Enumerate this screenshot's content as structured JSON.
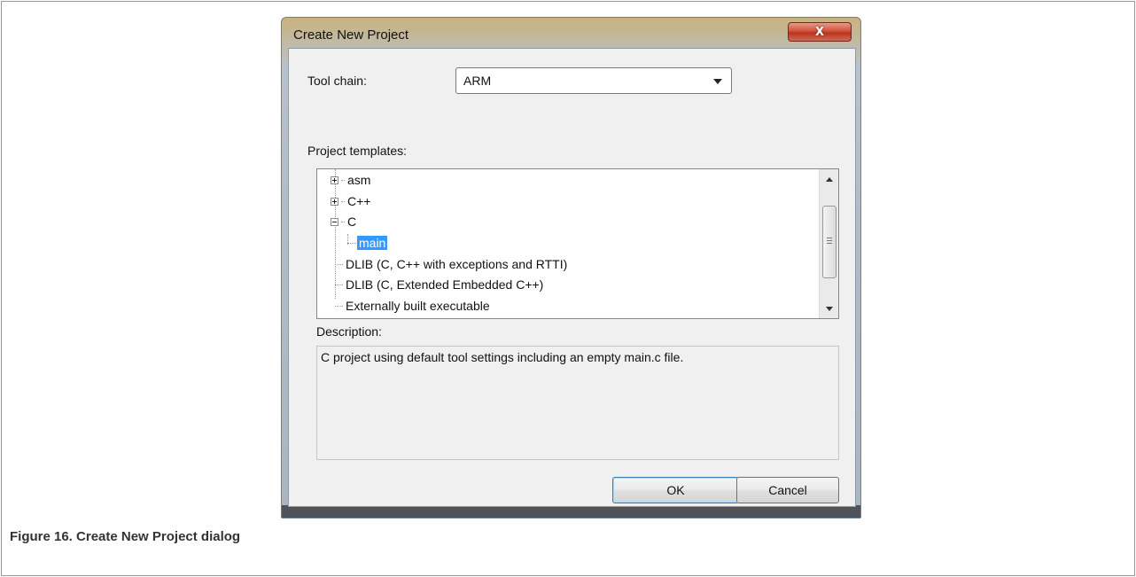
{
  "dialog": {
    "title": "Create New Project",
    "close_glyph": "X",
    "toolchain_label": "Tool chain:",
    "toolchain_value": "ARM",
    "templates_label": "Project templates:",
    "tree": {
      "items": [
        {
          "label": "asm",
          "expander": "plus"
        },
        {
          "label": "C++",
          "expander": "plus"
        },
        {
          "label": "C",
          "expander": "minus"
        },
        {
          "label": "main",
          "selected": true
        },
        {
          "label": "DLIB (C, C++ with exceptions and RTTI)"
        },
        {
          "label": "DLIB (C, Extended Embedded C++)"
        },
        {
          "label": "Externally built executable"
        }
      ]
    },
    "description_label": "Description:",
    "description_text": "C project using default tool settings including an empty main.c file.",
    "ok_label": "OK",
    "cancel_label": "Cancel"
  },
  "caption": "Figure 16. Create New Project dialog",
  "colors": {
    "selection": "#3399ff",
    "close_button": "#c9432c",
    "default_button_border": "#3c7fb1"
  },
  "icons": [
    "close-icon",
    "dropdown-arrow-icon",
    "tree-expand-icon",
    "tree-collapse-icon",
    "scroll-up-icon",
    "scroll-down-icon"
  ]
}
